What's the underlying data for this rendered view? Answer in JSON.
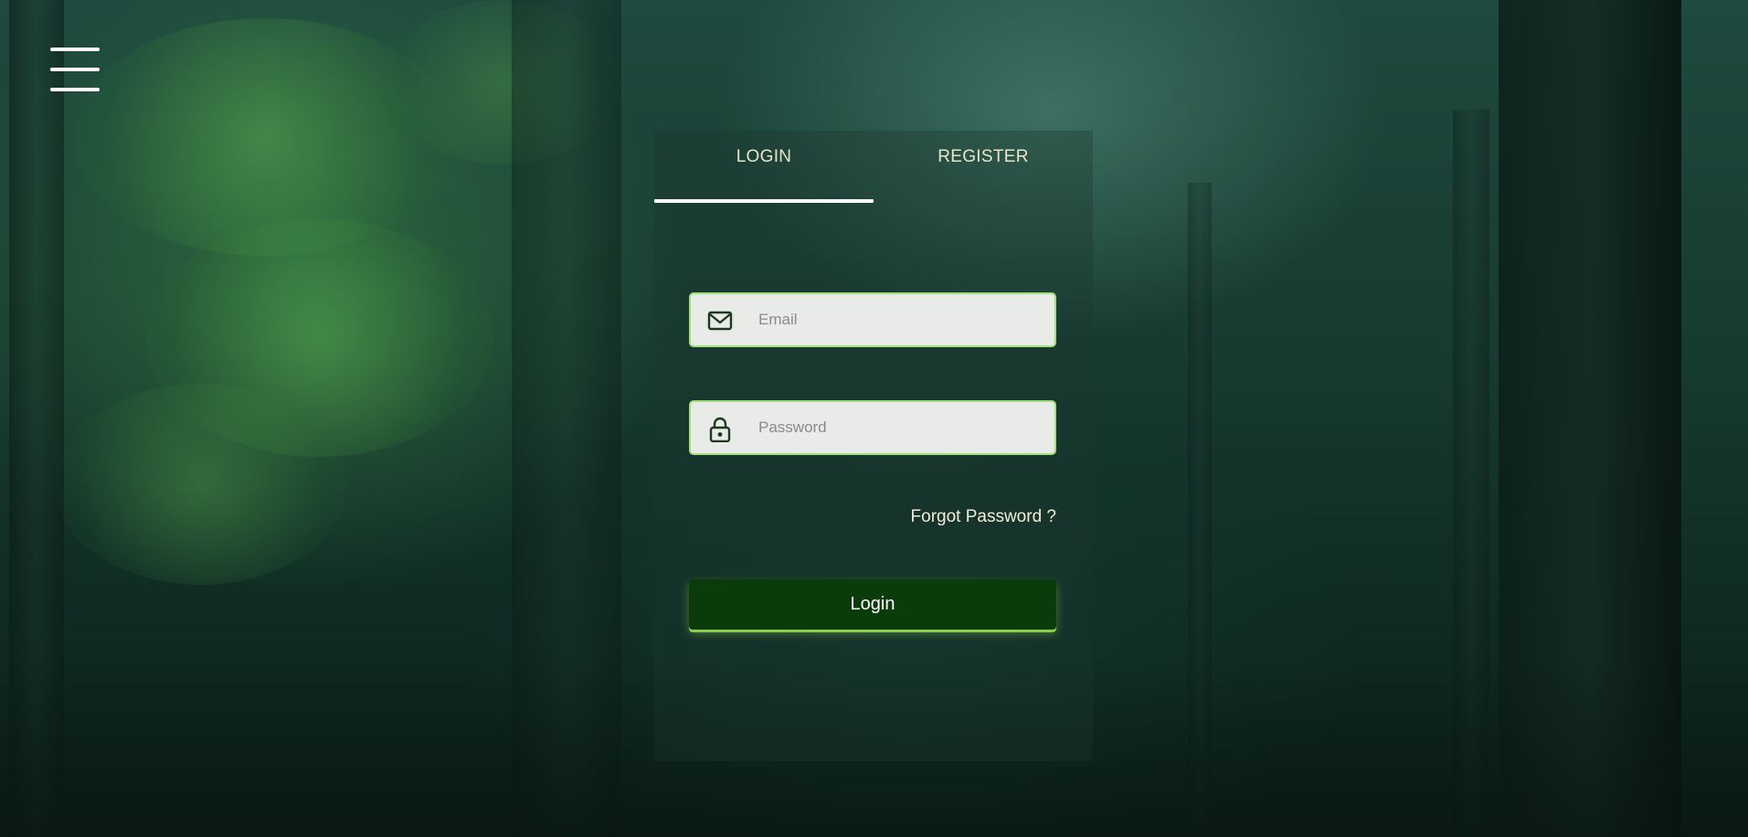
{
  "nav": {
    "menu_icon": "hamburger-icon"
  },
  "auth": {
    "tabs": [
      {
        "label": "LOGIN",
        "active": true
      },
      {
        "label": "REGISTER",
        "active": false
      }
    ],
    "email": {
      "icon": "mail-icon",
      "placeholder": "Email",
      "value": ""
    },
    "password": {
      "icon": "lock-icon",
      "placeholder": "Password",
      "value": ""
    },
    "forgot_password_label": "Forgot Password ?",
    "login_button_label": "Login"
  },
  "colors": {
    "field_border": "#9fe07a",
    "button_bg": "#0a3b0a",
    "button_glow": "#8fce4d",
    "tab_text": "#e8e6c8"
  }
}
